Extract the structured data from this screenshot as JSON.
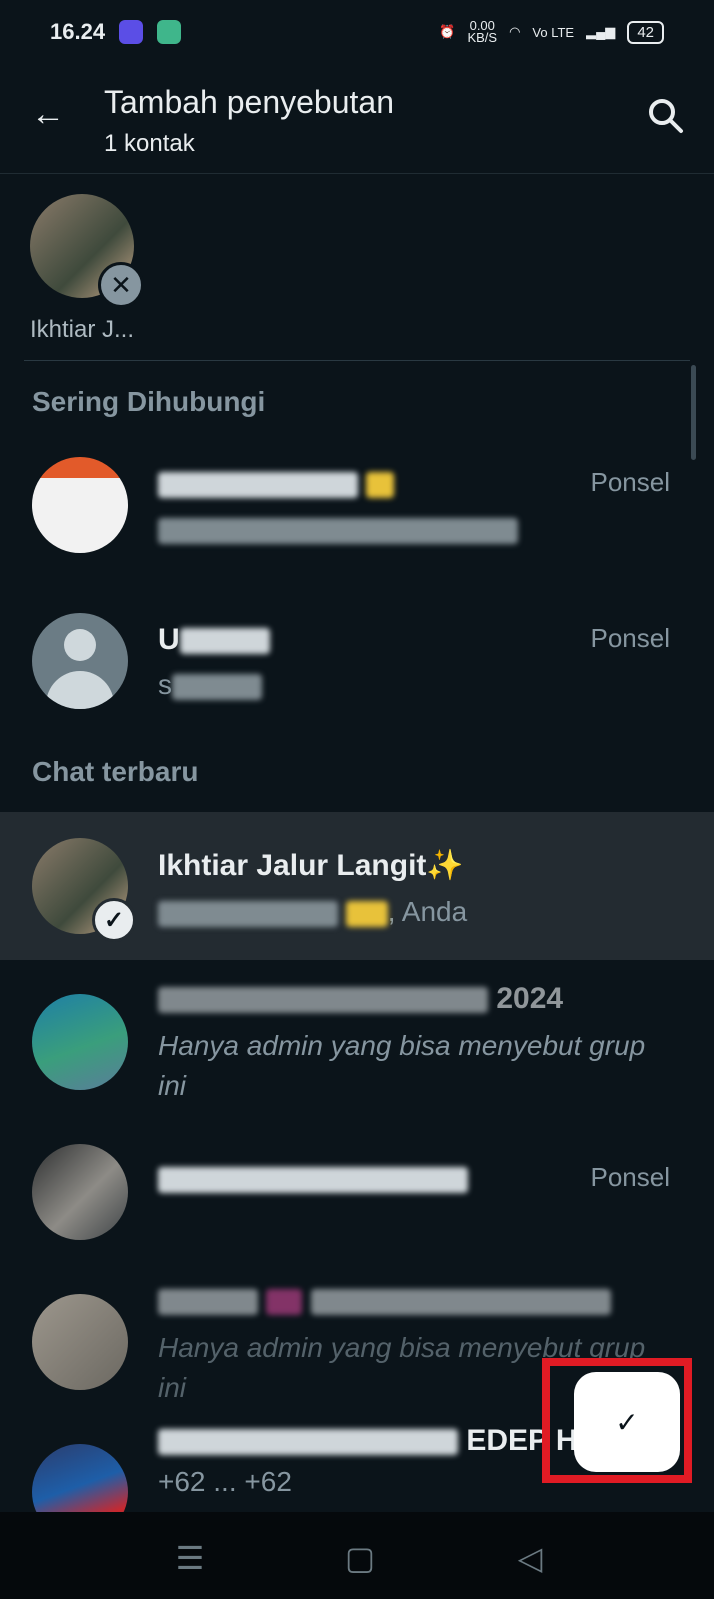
{
  "status_bar": {
    "time": "16.24",
    "net_speed_value": "0.00",
    "net_speed_unit": "KB/S",
    "network": "Vo LTE",
    "battery": "42"
  },
  "header": {
    "title": "Tambah penyebutan",
    "subtitle": "1 kontak"
  },
  "selected": [
    {
      "name": "Ikhtiar J..."
    }
  ],
  "sections": {
    "frequent": "Sering Dihubungi",
    "recent": "Chat terbaru"
  },
  "frequent_contacts": [
    {
      "type": "Ponsel"
    },
    {
      "name_prefix": "U",
      "sub_prefix": "s",
      "type": "Ponsel"
    }
  ],
  "recent_chats": [
    {
      "name": "Ikhtiar Jalur Langit✨",
      "sub_suffix": ", Anda",
      "selected": true
    },
    {
      "name_suffix": "2024",
      "sub": "Hanya admin yang bisa menyebut grup ini"
    },
    {
      "type": "Ponsel"
    },
    {
      "sub": "Hanya admin yang bisa menyebut grup ini"
    },
    {
      "name_suffix": "EDEP H",
      "sub": "+62 ... +62"
    }
  ],
  "fab": {
    "icon": "check-icon"
  },
  "colors": {
    "background": "#0b141a",
    "highlight": "#232b31",
    "accent_red": "#e01b24",
    "muted_text": "#8696a0"
  }
}
